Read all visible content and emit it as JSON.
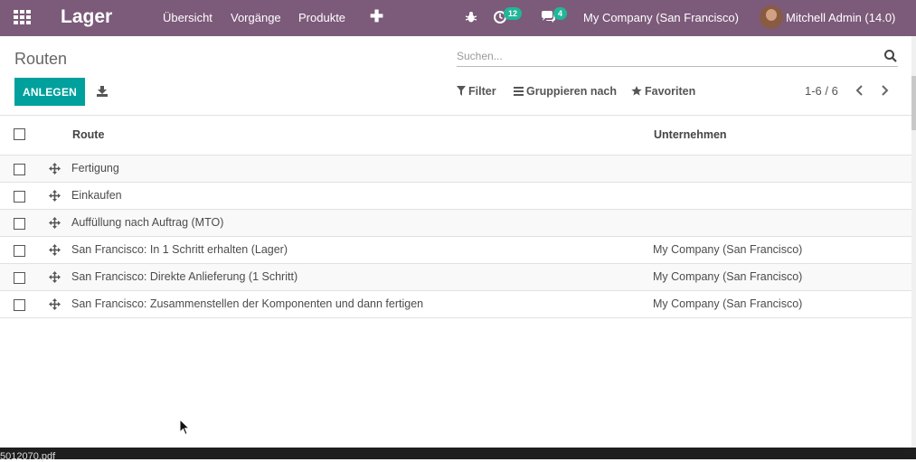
{
  "navbar": {
    "app_name": "Lager",
    "menus": [
      "Übersicht",
      "Vorgänge",
      "Produkte"
    ],
    "activity_count": "12",
    "messages_count": "4",
    "company": "My Company (San Francisco)",
    "user": "Mitchell Admin (14.0)",
    "color": "#7c5a7a"
  },
  "control": {
    "title": "Routen",
    "create_label": "ANLEGEN",
    "search_placeholder": "Suchen...",
    "filter_label": "Filter",
    "group_label": "Gruppieren nach",
    "favorites_label": "Favoriten",
    "pager": "1-6 / 6"
  },
  "table": {
    "columns": [
      "Route",
      "Unternehmen"
    ],
    "rows": [
      {
        "route": "Fertigung",
        "company": ""
      },
      {
        "route": "Einkaufen",
        "company": ""
      },
      {
        "route": "Auffüllung nach Auftrag (MTO)",
        "company": ""
      },
      {
        "route": "San Francisco: In 1 Schritt erhalten (Lager)",
        "company": "My Company (San Francisco)"
      },
      {
        "route": "San Francisco: Direkte Anlieferung (1 Schritt)",
        "company": "My Company (San Francisco)"
      },
      {
        "route": "San Francisco: Zusammenstellen der Komponenten und dann fertigen",
        "company": "My Company (San Francisco)"
      }
    ]
  },
  "bottombar": {
    "text": "5012070.pdf"
  },
  "colors": {
    "accent": "#00a09d",
    "badge": "#21b799"
  },
  "icons": [
    "apps-grid-icon",
    "bug-icon",
    "activity-clock-icon",
    "chat-icon",
    "search-icon",
    "download-icon",
    "filter-icon",
    "group-by-icon",
    "star-icon",
    "chevron-left-icon",
    "chevron-right-icon",
    "drag-handle-icon"
  ]
}
